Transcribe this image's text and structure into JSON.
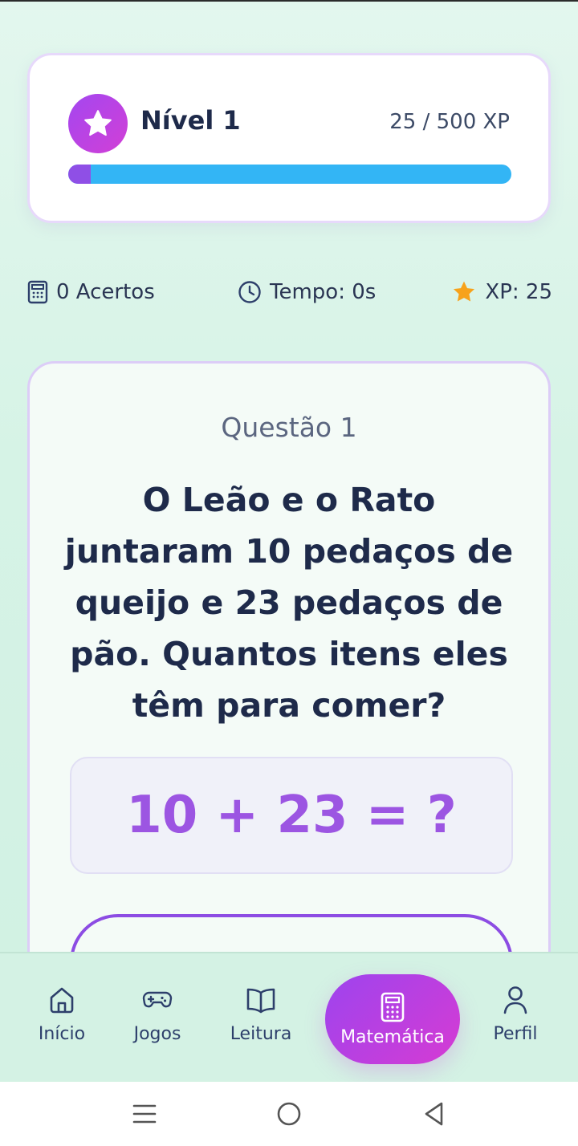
{
  "level": {
    "title": "Nível 1",
    "xp_text": "25 / 500 XP",
    "progress": 0.05
  },
  "stats": {
    "acertos": "0 Acertos",
    "tempo": "Tempo: 0s",
    "xp": "XP: 25"
  },
  "question": {
    "number": "Questão 1",
    "text": "O Leão e o Rato juntaram 10 pedaços de queijo e 23 pedaços de pão. Quantos itens eles têm para comer?",
    "equation": "10 + 23 = ?"
  },
  "nav": {
    "items": [
      {
        "label": "Início",
        "icon": "home-icon"
      },
      {
        "label": "Jogos",
        "icon": "gamepad-icon"
      },
      {
        "label": "Leitura",
        "icon": "book-icon"
      },
      {
        "label": "Matemática",
        "icon": "calculator-icon",
        "active": true
      },
      {
        "label": "Perfil",
        "icon": "user-icon"
      }
    ]
  },
  "colors": {
    "accent_purple": "#9d44ee",
    "accent_magenta": "#d63bd3",
    "progress_blue": "#33b5f5",
    "star_orange": "#f7a21b"
  }
}
